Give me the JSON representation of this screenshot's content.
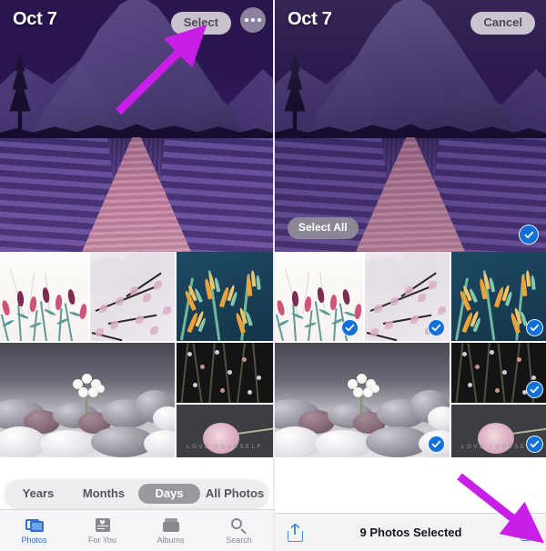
{
  "accent_blue": "#1271d8",
  "arrow_color": "#c81ee8",
  "panels": [
    {
      "id": "before",
      "header": {
        "date": "Oct 7",
        "select_label": "Select",
        "more_icon": "ellipsis-icon"
      },
      "segmented": {
        "options": [
          "Years",
          "Months",
          "Days",
          "All Photos"
        ],
        "selected": "Days"
      },
      "tabbar": [
        {
          "label": "Photos",
          "icon": "photos-icon",
          "active": true
        },
        {
          "label": "For You",
          "icon": "for-you-icon",
          "active": false
        },
        {
          "label": "Albums",
          "icon": "albums-icon",
          "active": false
        },
        {
          "label": "Search",
          "icon": "search-icon",
          "active": false
        }
      ]
    },
    {
      "id": "after",
      "header": {
        "date": "Oct 7",
        "cancel_label": "Cancel"
      },
      "select_all_label": "Select All",
      "action_bar": {
        "share_icon": "share-icon",
        "status": "9 Photos Selected",
        "trash_icon": "trash-icon"
      }
    }
  ],
  "photos": [
    {
      "name": "lavender-field-mountain",
      "caption": ""
    },
    {
      "name": "lavender-illustration",
      "caption": ""
    },
    {
      "name": "cherry-blossom-gray",
      "caption": ""
    },
    {
      "name": "bird-of-paradise-navy",
      "caption": ""
    },
    {
      "name": "stones-white-flower",
      "caption": ""
    },
    {
      "name": "dark-botanical-pattern",
      "caption": ""
    },
    {
      "name": "love-yourself-bloom",
      "caption": "LOVE YOURSELF"
    }
  ],
  "annotations": [
    {
      "name": "arrow-to-select-button",
      "target": "Select"
    },
    {
      "name": "arrow-to-trash-button",
      "target": "trash-icon"
    }
  ]
}
